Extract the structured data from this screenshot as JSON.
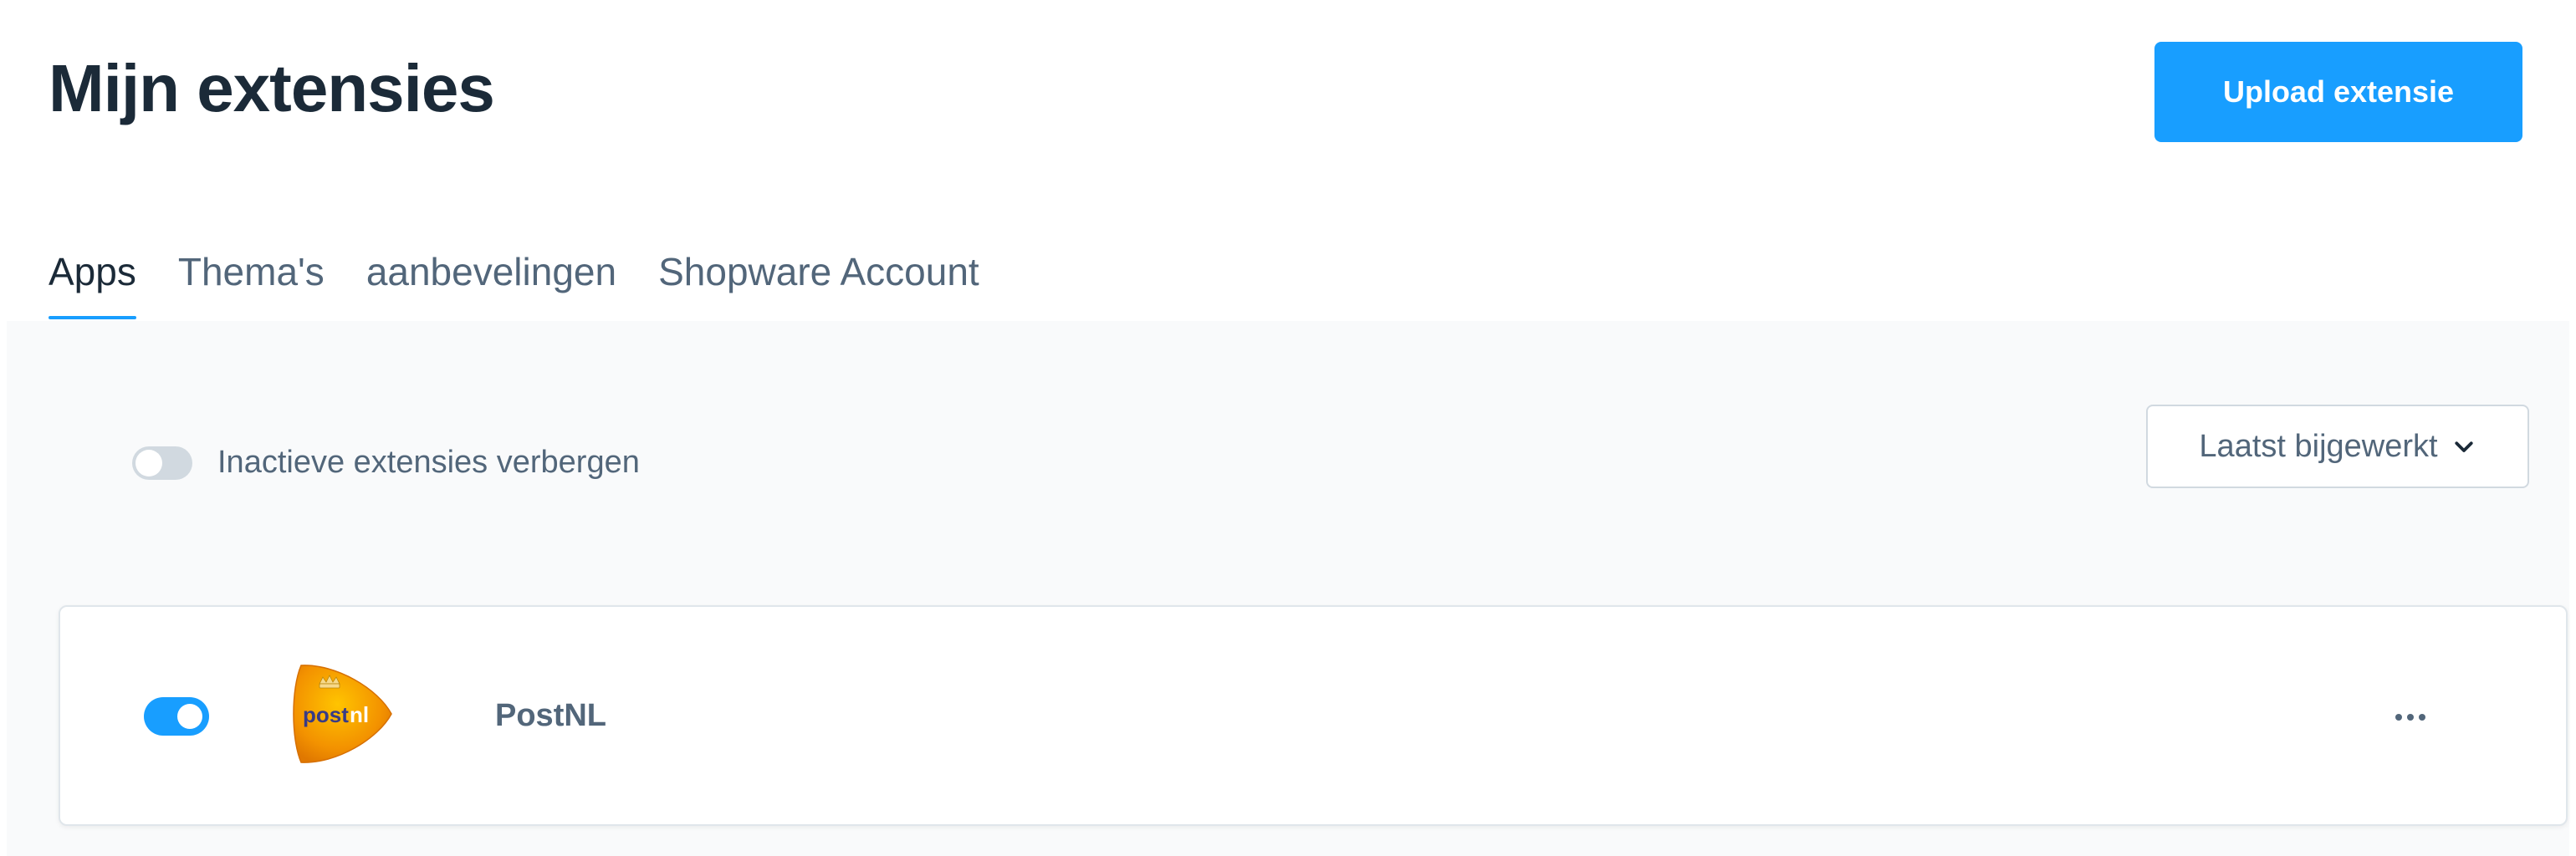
{
  "header": {
    "title": "Mijn extensies",
    "upload_label": "Upload extensie"
  },
  "tabs": [
    {
      "label": "Apps",
      "active": true
    },
    {
      "label": "Thema's",
      "active": false
    },
    {
      "label": "aanbevelingen",
      "active": false
    },
    {
      "label": "Shopware Account",
      "active": false
    }
  ],
  "filter": {
    "label": "Inactieve extensies verbergen",
    "enabled": false
  },
  "sort": {
    "selected": "Laatst bijgewerkt"
  },
  "extensions": [
    {
      "name": "PostNL",
      "active": true,
      "logo_text": {
        "part1": "post",
        "part2": "nl"
      }
    }
  ],
  "colors": {
    "accent": "#189eff",
    "postnl_orange": "#f39200",
    "postnl_dark": "#383b86"
  }
}
